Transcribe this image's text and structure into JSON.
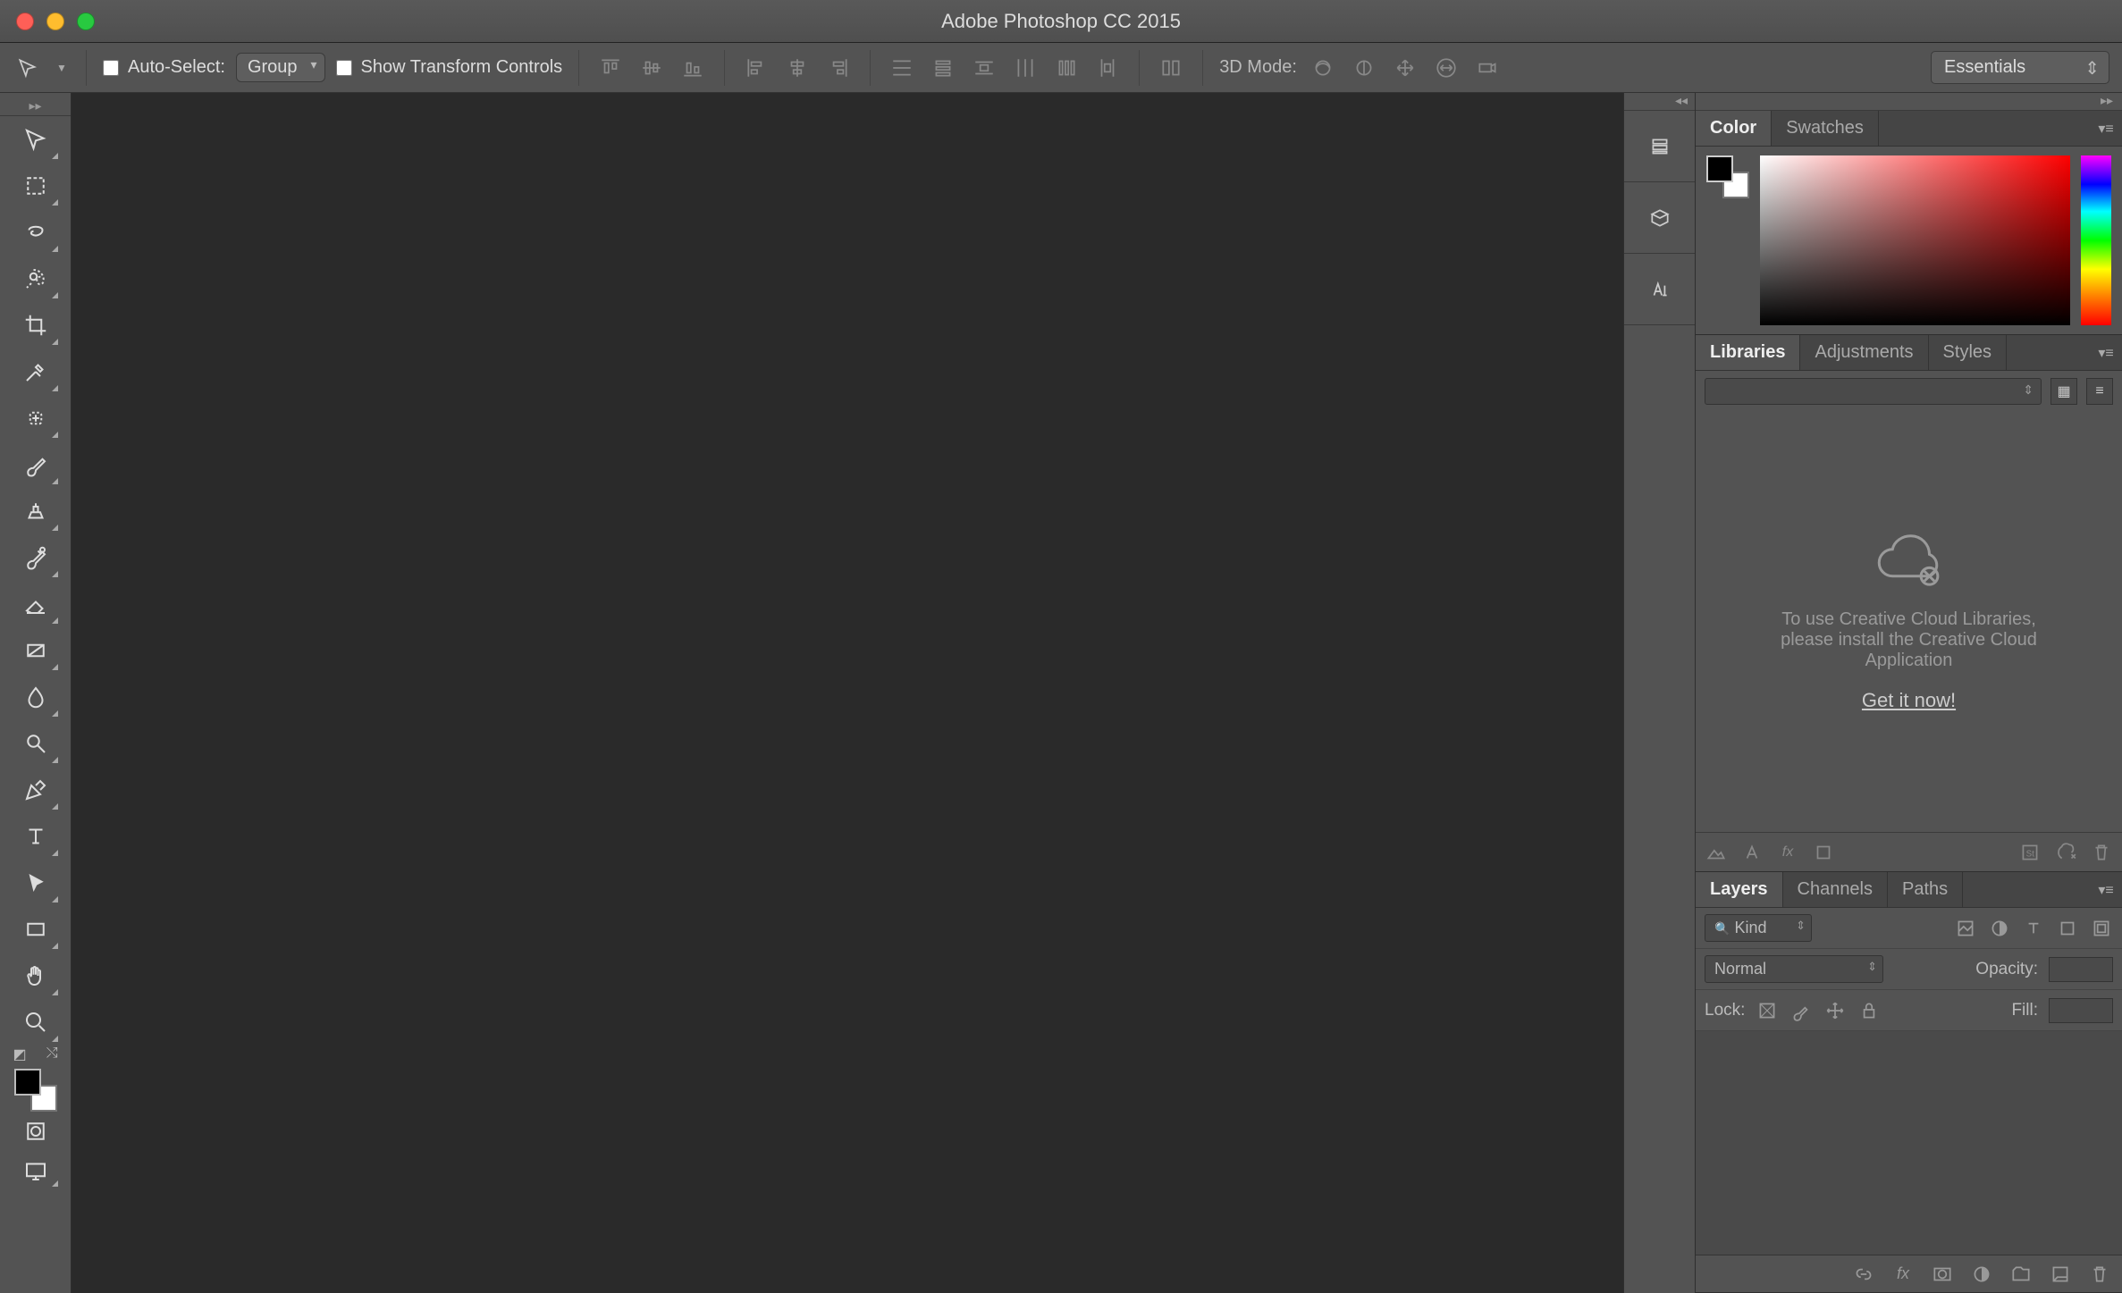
{
  "titlebar": {
    "title": "Adobe Photoshop CC 2015"
  },
  "options": {
    "auto_select_label": "Auto-Select:",
    "group_label": "Group",
    "show_transform_label": "Show Transform Controls",
    "mode3d_label": "3D Mode:",
    "workspace": "Essentials"
  },
  "tools": [
    "move",
    "marquee",
    "lasso",
    "quick-select",
    "crop",
    "eyedropper",
    "healing",
    "brush",
    "stamp",
    "history-brush",
    "eraser",
    "gradient",
    "blur",
    "dodge",
    "pen",
    "type",
    "path-select",
    "rectangle",
    "hand",
    "zoom"
  ],
  "panels": {
    "color": {
      "tabs": [
        "Color",
        "Swatches"
      ],
      "active": 0
    },
    "libraries": {
      "tabs": [
        "Libraries",
        "Adjustments",
        "Styles"
      ],
      "active": 0,
      "message_line1": "To use Creative Cloud Libraries,",
      "message_line2": "please install the Creative Cloud",
      "message_line3": "Application",
      "get_it_now": "Get it now!"
    },
    "layers": {
      "tabs": [
        "Layers",
        "Channels",
        "Paths"
      ],
      "active": 0,
      "kind_label": "Kind",
      "blend_mode": "Normal",
      "opacity_label": "Opacity:",
      "lock_label": "Lock:",
      "fill_label": "Fill:"
    }
  }
}
